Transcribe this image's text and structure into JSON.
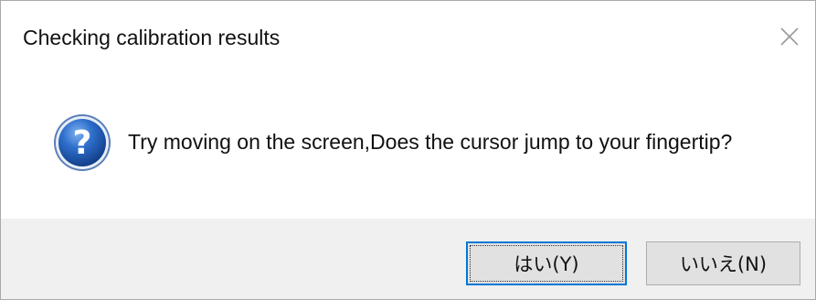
{
  "dialog": {
    "title": "Checking calibration results",
    "close_icon": "close-icon",
    "message_icon": "question-icon",
    "message": "Try moving on the screen,Does the cursor jump to your fingertip?",
    "buttons": {
      "yes_label": "はい(Y)",
      "no_label": "いいえ(N)"
    }
  },
  "colors": {
    "focus_border": "#0078d7",
    "button_face": "#e1e1e1",
    "footer_background": "#f0f0f0",
    "icon_blue": "#1f5fb4"
  }
}
